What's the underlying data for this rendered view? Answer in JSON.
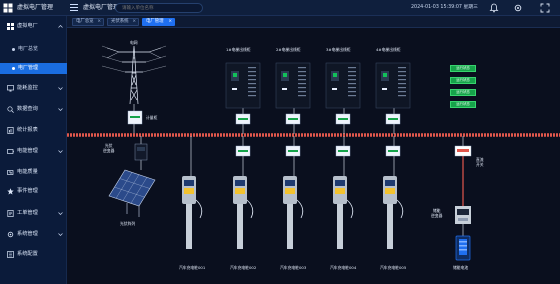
{
  "header": {
    "app_name": "虚拟电厂管理",
    "breadcrumb": "虚拟电厂管理",
    "search_placeholder": "请输入单位名称",
    "datetime": "2024-01-03 15:39:07 星期三"
  },
  "sidebar": {
    "groups": [
      {
        "label": "虚拟电厂",
        "icon": "grid-icon"
      },
      {
        "label": "能耗监控",
        "icon": "monitor-icon"
      },
      {
        "label": "数据查询",
        "icon": "search-data-icon"
      },
      {
        "label": "统计报表",
        "icon": "report-icon"
      },
      {
        "label": "电能管理",
        "icon": "power-icon"
      },
      {
        "label": "电能质量",
        "icon": "quality-icon"
      },
      {
        "label": "事件管理",
        "icon": "event-icon"
      },
      {
        "label": "工单管理",
        "icon": "workorder-icon"
      },
      {
        "label": "系统管理",
        "icon": "system-icon"
      },
      {
        "label": "系统配置",
        "icon": "config-icon"
      }
    ],
    "subitems": [
      {
        "label": "电厂总览",
        "active": false
      },
      {
        "label": "电厂管理",
        "active": true
      }
    ]
  },
  "tabs": [
    {
      "label": "电厂总览",
      "active": false
    },
    {
      "label": "光伏系统",
      "active": false
    },
    {
      "label": "电厂管理",
      "active": true
    }
  ],
  "diagram": {
    "grid_label": "电网",
    "meter_label": "计量柜",
    "pv_inverter_label": "光伏\n逆变器",
    "pv_label": "光伏阵列",
    "cabinets": [
      "1#电梯出线柜",
      "2#电梯出线柜",
      "3#电梯出线柜",
      "4#电梯出线柜"
    ],
    "chargers": [
      "汽车充电桩001",
      "汽车充电桩002",
      "汽车充电桩003",
      "汽车充电桩004",
      "汽车充电桩005"
    ],
    "switch_label": "直流\n开关",
    "storage_inverter_label": "储能\n逆变器",
    "battery_label": "储能电池",
    "status_buttons": [
      "运行状态",
      "运行状态",
      "运行状态",
      "运行状态"
    ],
    "accent": "#1f6ff0",
    "green": "#16a34a",
    "bus_color": "#e2574c"
  }
}
